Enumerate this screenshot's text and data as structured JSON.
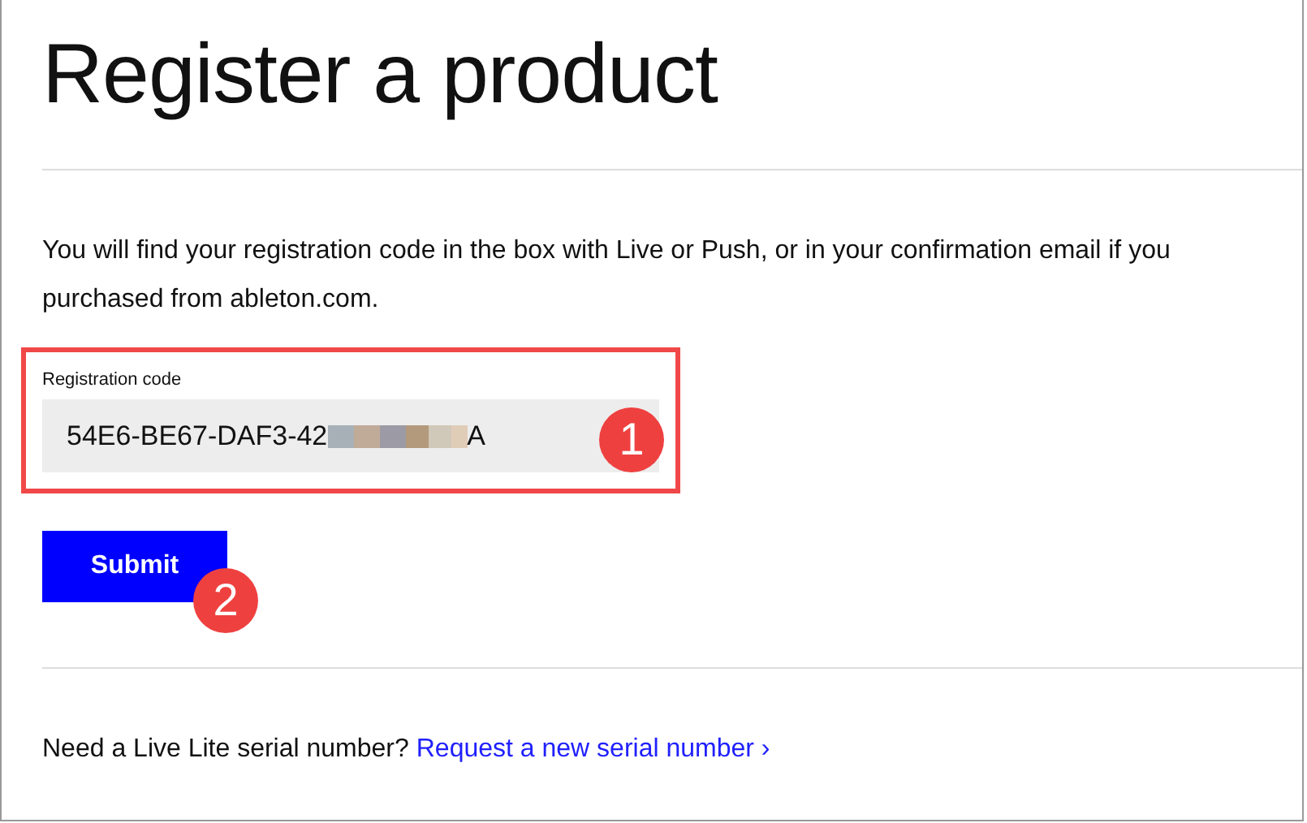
{
  "page": {
    "title": "Register a product"
  },
  "intro": "You will find your registration code in the box with Live or Push, or in your confirmation email if you purchased from ableton.com.",
  "registration": {
    "label": "Registration code",
    "value_start": "54E6-BE67-DAF3-42",
    "value_end": "A"
  },
  "submit": "Submit",
  "callouts": [
    "1",
    "2"
  ],
  "footer": {
    "text": "Need a Live Lite serial number?",
    "link": "Request a new serial number ›"
  }
}
